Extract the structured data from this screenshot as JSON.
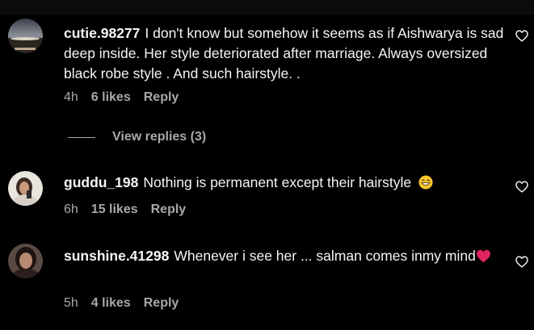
{
  "comments": [
    {
      "username": "cutie.98277",
      "text": "I don't know but somehow it seems as if Aishwarya is sad deep inside. Her style deteriorated after marriage. Always oversized black robe style . And such hairstyle. .",
      "time": "4h",
      "likes": "6 likes",
      "reply": "Reply",
      "view_replies": "View replies (3)",
      "avatar_icon": "sunset-landscape-avatar"
    },
    {
      "username": "guddu_198",
      "text": "Nothing is permanent except their hairstyle",
      "emoji": "grinning-face-emoji",
      "time": "6h",
      "likes": "15 likes",
      "reply": "Reply",
      "avatar_icon": "person-selfie-avatar"
    },
    {
      "username": "sunshine.41298",
      "text": "Whenever i see her ... salman comes inmy mind",
      "emoji": "red-heart-emoji",
      "time": "5h",
      "likes": "4 likes",
      "reply": "Reply",
      "avatar_icon": "woman-portrait-avatar"
    }
  ],
  "icons": {
    "like": "heart-outline-icon"
  },
  "colors": {
    "background": "#000000",
    "primary_text": "#f5f5f5",
    "secondary_text": "#a8a8a8",
    "heart_emoji": "#e0245e"
  }
}
